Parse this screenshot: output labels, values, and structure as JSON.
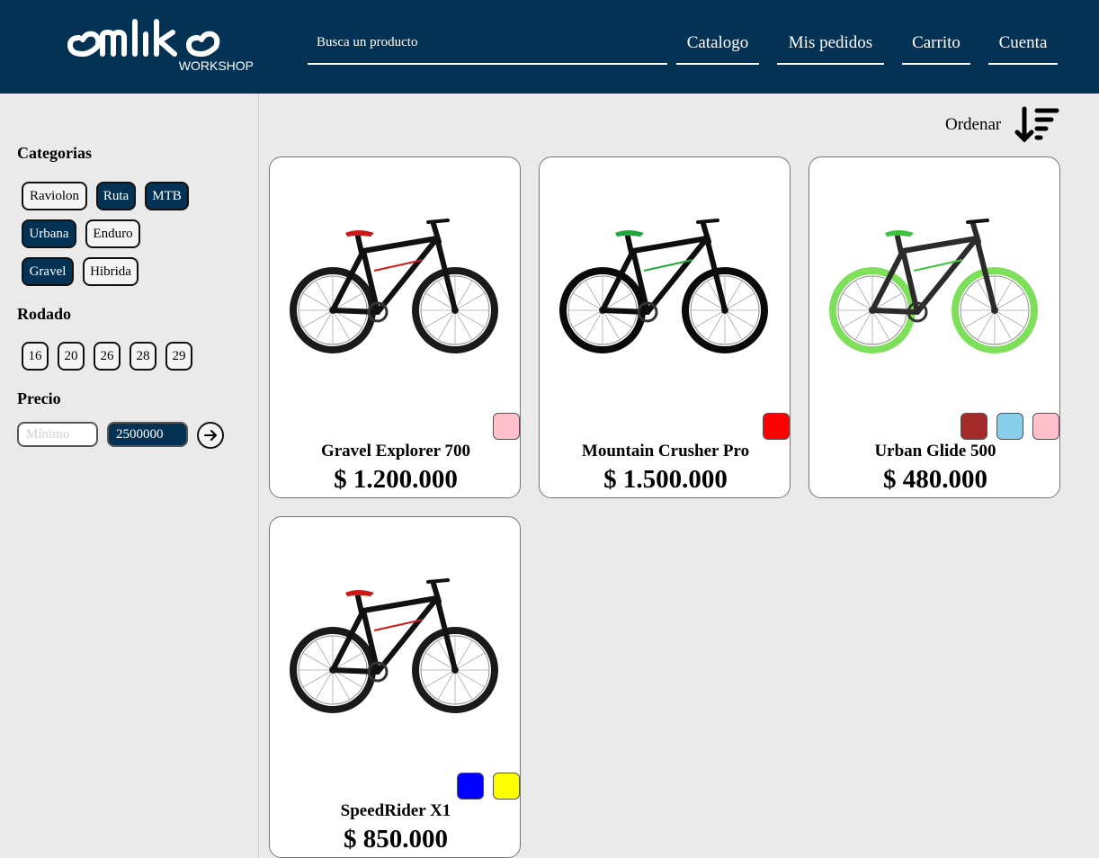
{
  "header": {
    "logo_text": "emlike",
    "logo_sub": "WORKSHOP",
    "search_placeholder": "Busca un producto",
    "nav": [
      "Catalogo",
      "Mis pedidos",
      "Carrito",
      "Cuenta"
    ]
  },
  "sidebar": {
    "categories_title": "Categorias",
    "categories": [
      {
        "label": "Raviolon",
        "active": false
      },
      {
        "label": "Ruta",
        "active": true
      },
      {
        "label": "MTB",
        "active": true
      },
      {
        "label": "Urbana",
        "active": true
      },
      {
        "label": "Enduro",
        "active": false
      },
      {
        "label": "Gravel",
        "active": true
      },
      {
        "label": "Hibrida",
        "active": false
      }
    ],
    "rodado_title": "Rodado",
    "rodados": [
      "16",
      "20",
      "26",
      "28",
      "29"
    ],
    "precio_title": "Precio",
    "price_min_placeholder": "Mínimo",
    "price_max_value": "2500000"
  },
  "sort": {
    "label": "Ordenar",
    "icon": "sort-descending-icon"
  },
  "products": [
    {
      "name": "Gravel Explorer 700",
      "price": "$ 1.200.000",
      "colors": [
        "#ffc0cb"
      ],
      "frame": "#111111",
      "accent": "#d01818",
      "tire": "#1a1a1a"
    },
    {
      "name": "Mountain Crusher Pro",
      "price": "$ 1.500.000",
      "colors": [
        "#ff0000"
      ],
      "frame": "#0d0d0d",
      "accent": "#22a83a",
      "tire": "#0a0a0a"
    },
    {
      "name": "Urban Glide 500",
      "price": "$ 480.000",
      "colors": [
        "#a52a2a",
        "#87ceeb",
        "#ffc0cb"
      ],
      "frame": "#2b2b2b",
      "accent": "#3cc23c",
      "tire": "#7ee05a"
    },
    {
      "name": "SpeedRider X1",
      "price": "$ 850.000",
      "colors": [
        "#0000ff",
        "#ffff00"
      ],
      "frame": "#111111",
      "accent": "#d01818",
      "tire": "#1a1a1a"
    }
  ]
}
